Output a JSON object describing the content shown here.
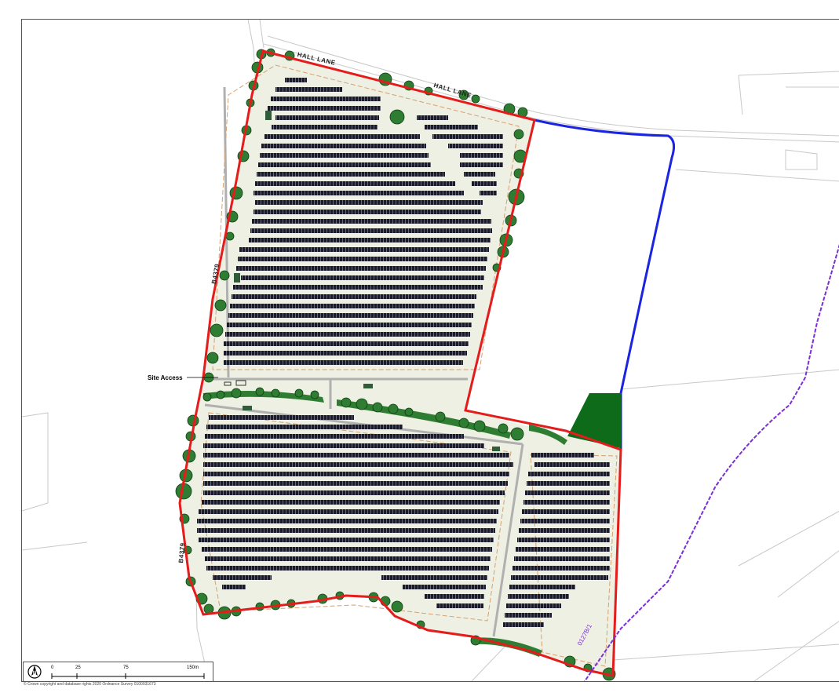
{
  "map": {
    "road_labels": {
      "hall_lane_1": "HALL LANE",
      "hall_lane_2": "HALL LANE",
      "b4379_1": "B4379",
      "b4379_2": "B4379"
    },
    "annotations": {
      "site_access": "Site Access",
      "public_right_of_way": "0127B/1"
    },
    "colors": {
      "site_boundary": "#e41c1c",
      "blue_land": "#1b24e0",
      "right_of_way": "#7a2fd6",
      "field": "#eef0e4",
      "panels": "#1a1a2e",
      "trees": "#2f7d32",
      "woodland": "#0e6b1a"
    }
  },
  "scalebar": {
    "ticks": [
      "0",
      "25",
      "75",
      "150m"
    ],
    "north_icon": "north-arrow-icon"
  },
  "footer": {
    "copyright": "© Crown copyright and database rights 2020 Ordnance Survey 0100031673"
  }
}
